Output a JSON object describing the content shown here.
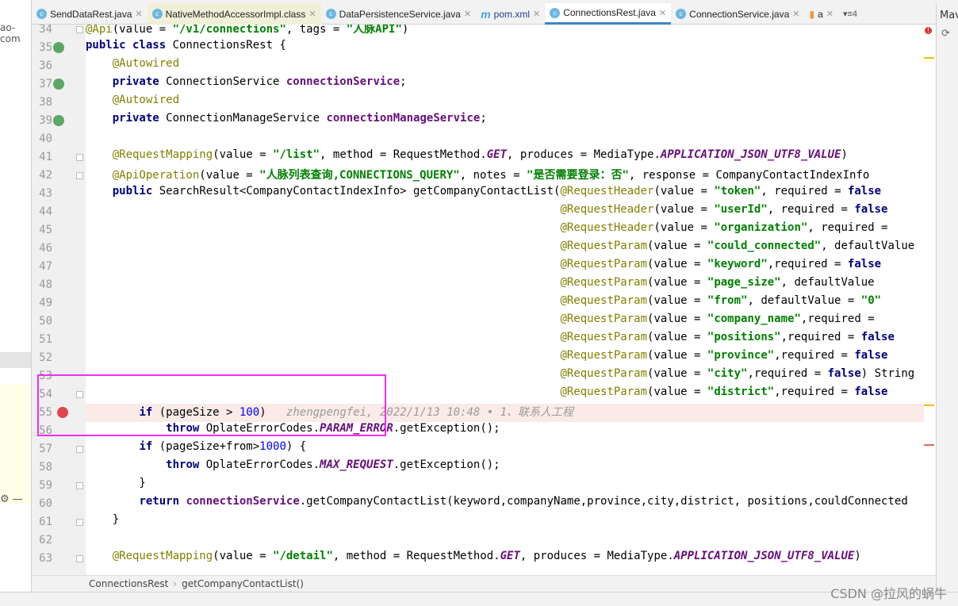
{
  "tabs": [
    {
      "label": "SendDataRest.java",
      "icon": "class-icon"
    },
    {
      "label": "NativeMethodAccessorImpl.class",
      "icon": "class-icon",
      "pinned": true
    },
    {
      "label": "DataPersistenceService.java",
      "icon": "class-icon"
    },
    {
      "label": "pom.xml",
      "icon": "maven-icon"
    },
    {
      "label": "ConnectionsRest.java",
      "icon": "class-icon",
      "active": true
    },
    {
      "label": "ConnectionService.java",
      "icon": "class-icon"
    },
    {
      "label": "a",
      "icon": "chart-icon"
    }
  ],
  "tab_overflow": "▾≡4",
  "left_panel_text": "ao-com",
  "right_panel_title": "Mav",
  "lines": [
    {
      "n": "34",
      "t": [
        [
          "ann",
          "@Api"
        ],
        [
          "",
          "(value = "
        ],
        [
          "str",
          "\"/v1/connections\""
        ],
        [
          "",
          ", tags = "
        ],
        [
          "str",
          "\"人脉API\""
        ],
        [
          "",
          ")"
        ]
      ]
    },
    {
      "n": "35",
      "t": [
        [
          "kw",
          "public class "
        ],
        [
          "",
          "ConnectionsRest {"
        ]
      ]
    },
    {
      "n": "36",
      "t": [
        [
          "",
          "    "
        ],
        [
          "ann",
          "@Autowired"
        ]
      ]
    },
    {
      "n": "37",
      "t": [
        [
          "",
          "    "
        ],
        [
          "kw",
          "private "
        ],
        [
          "",
          "ConnectionService "
        ],
        [
          "fld",
          "connectionService"
        ],
        [
          "",
          ";"
        ]
      ]
    },
    {
      "n": "38",
      "t": [
        [
          "",
          "    "
        ],
        [
          "ann",
          "@Autowired"
        ]
      ]
    },
    {
      "n": "39",
      "t": [
        [
          "",
          "    "
        ],
        [
          "kw",
          "private "
        ],
        [
          "",
          "ConnectionManageService "
        ],
        [
          "fld",
          "connectionManageService"
        ],
        [
          "",
          ";"
        ]
      ]
    },
    {
      "n": "40",
      "t": []
    },
    {
      "n": "41",
      "t": [
        [
          "",
          "    "
        ],
        [
          "ann",
          "@RequestMapping"
        ],
        [
          "",
          "(value = "
        ],
        [
          "str",
          "\"/list\""
        ],
        [
          "",
          ", method = RequestMethod."
        ],
        [
          "cst",
          "GET"
        ],
        [
          "",
          ", produces = MediaType."
        ],
        [
          "cst",
          "APPLICATION_JSON_UTF8_VALUE"
        ],
        [
          "",
          ")"
        ]
      ]
    },
    {
      "n": "42",
      "t": [
        [
          "",
          "    "
        ],
        [
          "ann",
          "@ApiOperation"
        ],
        [
          "",
          "(value = "
        ],
        [
          "str",
          "\"人脉列表查询,CONNECTIONS_QUERY\""
        ],
        [
          "",
          ", notes = "
        ],
        [
          "str",
          "\"是否需要登录：否\""
        ],
        [
          "",
          ", response = CompanyContactIndexInfo"
        ]
      ]
    },
    {
      "n": "43",
      "t": [
        [
          "",
          "    "
        ],
        [
          "kw",
          "public "
        ],
        [
          "",
          "SearchResult<CompanyContactIndexInfo> getCompanyContactList("
        ],
        [
          "ann",
          "@RequestHeader"
        ],
        [
          "",
          "(value = "
        ],
        [
          "str",
          "\"token\""
        ],
        [
          "",
          ", required = "
        ],
        [
          "kw",
          "false"
        ]
      ]
    },
    {
      "n": "44",
      "t": [
        [
          "",
          "                                                                       "
        ],
        [
          "ann",
          "@RequestHeader"
        ],
        [
          "",
          "(value = "
        ],
        [
          "str",
          "\"userId\""
        ],
        [
          "",
          ", required = "
        ],
        [
          "kw",
          "false"
        ]
      ]
    },
    {
      "n": "45",
      "t": [
        [
          "",
          "                                                                       "
        ],
        [
          "ann",
          "@RequestHeader"
        ],
        [
          "",
          "(value = "
        ],
        [
          "str",
          "\"organization\""
        ],
        [
          "",
          ", required = "
        ]
      ]
    },
    {
      "n": "46",
      "t": [
        [
          "",
          "                                                                       "
        ],
        [
          "ann",
          "@RequestParam"
        ],
        [
          "",
          "(value = "
        ],
        [
          "str",
          "\"could_connected\""
        ],
        [
          "",
          ", defaultValue"
        ]
      ]
    },
    {
      "n": "47",
      "t": [
        [
          "",
          "                                                                       "
        ],
        [
          "ann",
          "@RequestParam"
        ],
        [
          "",
          "(value = "
        ],
        [
          "str",
          "\"keyword\""
        ],
        [
          "",
          ",required = "
        ],
        [
          "kw",
          "false"
        ]
      ]
    },
    {
      "n": "48",
      "t": [
        [
          "",
          "                                                                       "
        ],
        [
          "ann",
          "@RequestParam"
        ],
        [
          "",
          "(value = "
        ],
        [
          "str",
          "\"page_size\""
        ],
        [
          "",
          ", defaultValue"
        ]
      ]
    },
    {
      "n": "49",
      "t": [
        [
          "",
          "                                                                       "
        ],
        [
          "ann",
          "@RequestParam"
        ],
        [
          "",
          "(value = "
        ],
        [
          "str",
          "\"from\""
        ],
        [
          "",
          ", defaultValue = "
        ],
        [
          "str",
          "\"0\""
        ]
      ]
    },
    {
      "n": "50",
      "t": [
        [
          "",
          "                                                                       "
        ],
        [
          "ann",
          "@RequestParam"
        ],
        [
          "",
          "(value = "
        ],
        [
          "str",
          "\"company_name\""
        ],
        [
          "",
          ",required = "
        ]
      ]
    },
    {
      "n": "51",
      "t": [
        [
          "",
          "                                                                       "
        ],
        [
          "ann",
          "@RequestParam"
        ],
        [
          "",
          "(value = "
        ],
        [
          "str",
          "\"positions\""
        ],
        [
          "",
          ",required = "
        ],
        [
          "kw",
          "false"
        ]
      ]
    },
    {
      "n": "52",
      "t": [
        [
          "",
          "                                                                       "
        ],
        [
          "ann",
          "@RequestParam"
        ],
        [
          "",
          "(value = "
        ],
        [
          "str",
          "\"province\""
        ],
        [
          "",
          ",required = "
        ],
        [
          "kw",
          "false"
        ]
      ]
    },
    {
      "n": "53",
      "t": [
        [
          "",
          "                                                                       "
        ],
        [
          "ann",
          "@RequestParam"
        ],
        [
          "",
          "(value = "
        ],
        [
          "str",
          "\"city\""
        ],
        [
          "",
          ",required = "
        ],
        [
          "kw",
          "false"
        ],
        [
          "",
          ") String"
        ]
      ]
    },
    {
      "n": "54",
      "t": [
        [
          "",
          "                                                                       "
        ],
        [
          "ann",
          "@RequestParam"
        ],
        [
          "",
          "(value = "
        ],
        [
          "str",
          "\"district\""
        ],
        [
          "",
          ",required = "
        ],
        [
          "kw",
          "false"
        ]
      ]
    },
    {
      "n": "55",
      "t": [
        [
          "",
          "        "
        ],
        [
          "kw",
          "if "
        ],
        [
          "",
          "(pageSize > "
        ],
        [
          "num",
          "100"
        ],
        [
          "",
          ")   "
        ],
        [
          "blame",
          "zhengpengfei, 2022/1/13 10:48 • 1、联系人工程"
        ]
      ]
    },
    {
      "n": "56",
      "t": [
        [
          "",
          "            "
        ],
        [
          "kw",
          "throw "
        ],
        [
          "",
          "OplateErrorCodes."
        ],
        [
          "cst",
          "PARAM_ERROR"
        ],
        [
          "",
          ".getException();"
        ]
      ]
    },
    {
      "n": "57",
      "t": [
        [
          "",
          "        "
        ],
        [
          "kw",
          "if "
        ],
        [
          "",
          "(pageSize+from>"
        ],
        [
          "num",
          "1000"
        ],
        [
          "",
          ") {"
        ]
      ]
    },
    {
      "n": "58",
      "t": [
        [
          "",
          "            "
        ],
        [
          "kw",
          "throw "
        ],
        [
          "",
          "OplateErrorCodes."
        ],
        [
          "cst",
          "MAX_REQUEST"
        ],
        [
          "",
          ".getException();"
        ]
      ]
    },
    {
      "n": "59",
      "t": [
        [
          "",
          "        }"
        ]
      ]
    },
    {
      "n": "60",
      "t": [
        [
          "",
          "        "
        ],
        [
          "kw",
          "return "
        ],
        [
          "fld",
          "connectionService"
        ],
        [
          "",
          ".getCompanyContactList(keyword,companyName,province,city,district, positions,couldConnected"
        ]
      ]
    },
    {
      "n": "61",
      "t": [
        [
          "",
          "    }"
        ]
      ]
    },
    {
      "n": "62",
      "t": []
    },
    {
      "n": "63",
      "t": [
        [
          "",
          "    "
        ],
        [
          "ann",
          "@RequestMapping"
        ],
        [
          "",
          "(value = "
        ],
        [
          "str",
          "\"/detail\""
        ],
        [
          "",
          ", method = RequestMethod."
        ],
        [
          "cst",
          "GET"
        ],
        [
          "",
          ", produces = MediaType."
        ],
        [
          "cst",
          "APPLICATION_JSON_UTF8_VALUE"
        ],
        [
          "",
          ")"
        ]
      ]
    }
  ],
  "breakpoint_line": "55",
  "breadcrumb": {
    "class": "ConnectionsRest",
    "method": "getCompanyContactList()",
    "sep": "›"
  },
  "watermark": "CSDN @拉风的蜗牛",
  "colors": {
    "highlight_box": "#f02ef0",
    "breakpoint": "#e0474c",
    "active_tab": "#4083c9"
  }
}
